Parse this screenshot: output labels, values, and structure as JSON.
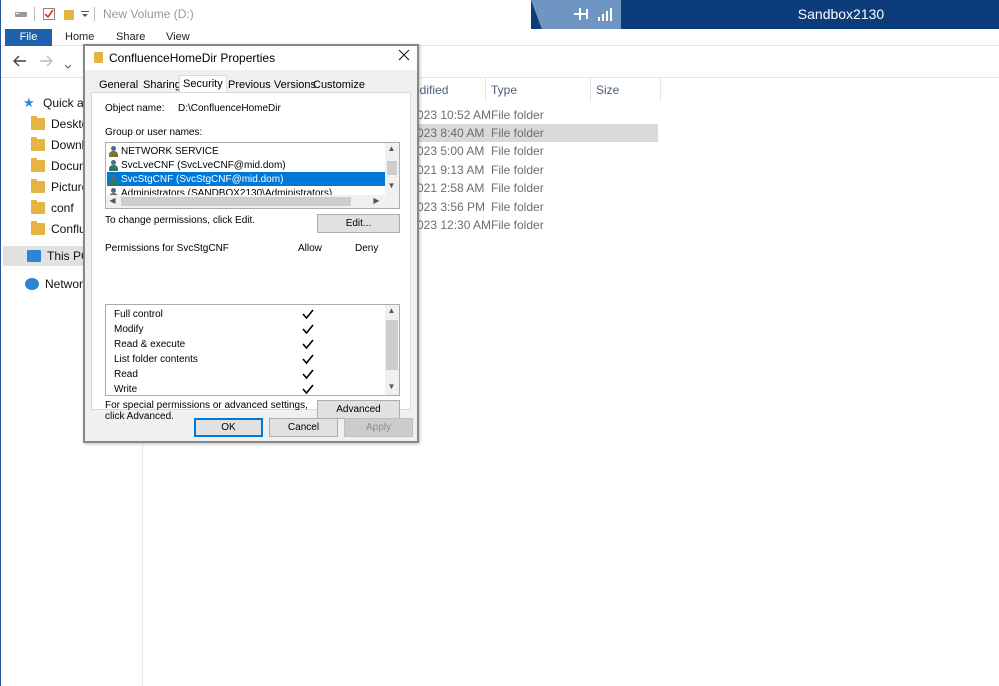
{
  "explorer": {
    "window_title": "New Volume (D:)",
    "vm_name": "Sandbox2130",
    "ribbon_tabs": [
      "File",
      "Home",
      "Share",
      "View"
    ],
    "nav_items": [
      {
        "label": "Quick access",
        "icon": "star-icon"
      },
      {
        "label": "Desktop",
        "icon": "folder-icon"
      },
      {
        "label": "Downloads",
        "icon": "folder-icon"
      },
      {
        "label": "Documents",
        "icon": "folder-icon"
      },
      {
        "label": "Pictures",
        "icon": "folder-icon"
      },
      {
        "label": "conf",
        "icon": "folder-icon"
      },
      {
        "label": "Confluence",
        "icon": "folder-icon"
      },
      {
        "label": "This PC",
        "icon": "pc-icon"
      },
      {
        "label": "Network",
        "icon": "network-icon"
      }
    ],
    "columns": {
      "modified": "odified",
      "type": "Type",
      "size": "Size"
    },
    "rows": [
      {
        "modified": "023 10:52 AM",
        "type": "File folder",
        "selected": false
      },
      {
        "modified": "023 8:40 AM",
        "type": "File folder",
        "selected": true
      },
      {
        "modified": "023 5:00 AM",
        "type": "File folder",
        "selected": false
      },
      {
        "modified": "021 9:13 AM",
        "type": "File folder",
        "selected": false
      },
      {
        "modified": "021 2:58 AM",
        "type": "File folder",
        "selected": false
      },
      {
        "modified": "023 3:56 PM",
        "type": "File folder",
        "selected": false
      },
      {
        "modified": "023 12:30 AM",
        "type": "File folder",
        "selected": false
      }
    ]
  },
  "dialog": {
    "title": "ConfluenceHomeDir Properties",
    "tabs": [
      "General",
      "Sharing",
      "Security",
      "Previous Versions",
      "Customize"
    ],
    "active_tab": "Security",
    "object_name_label": "Object name:",
    "object_name_value": "D:\\ConfluenceHomeDir",
    "group_label": "Group or user names:",
    "users": [
      {
        "name": "NETWORK SERVICE",
        "selected": false,
        "icon": "group"
      },
      {
        "name": "SvcLveCNF (SvcLveCNF@mid.dom)",
        "selected": false,
        "icon": "user"
      },
      {
        "name": "SvcStgCNF (SvcStgCNF@mid.dom)",
        "selected": true,
        "icon": "user"
      },
      {
        "name": "Administrators (SANDBOX2130\\Administrators)",
        "selected": false,
        "icon": "group"
      }
    ],
    "change_hint": "To change permissions, click Edit.",
    "edit_button": "Edit...",
    "permissions_for": "Permissions for SvcStgCNF",
    "allow_header": "Allow",
    "deny_header": "Deny",
    "permissions": [
      {
        "name": "Full control",
        "allow": true,
        "deny": false
      },
      {
        "name": "Modify",
        "allow": true,
        "deny": false
      },
      {
        "name": "Read & execute",
        "allow": true,
        "deny": false
      },
      {
        "name": "List folder contents",
        "allow": true,
        "deny": false
      },
      {
        "name": "Read",
        "allow": true,
        "deny": false
      },
      {
        "name": "Write",
        "allow": true,
        "deny": false
      }
    ],
    "special_hint_line1": "For special permissions or advanced settings,",
    "special_hint_line2": "click Advanced.",
    "advanced_button": "Advanced",
    "ok_button": "OK",
    "cancel_button": "Cancel",
    "apply_button": "Apply"
  }
}
